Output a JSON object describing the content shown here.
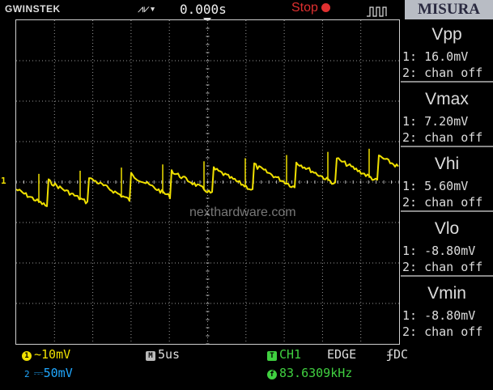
{
  "topbar": {
    "brand": "GWINSTEK",
    "trigger_icon_glyph": "⩘⩗▾",
    "time_delay": "0.000s",
    "status": "Stop",
    "panel_header": "MISURA"
  },
  "channel_marker": "1",
  "watermark": "nexthardware.com",
  "colors": {
    "ch1": "#f0e000",
    "ch2": "#20a8ff",
    "status": "#e03030",
    "accent_green": "#40d040"
  },
  "measurements": [
    {
      "title": "Vpp",
      "ch1": "1: 16.0mV",
      "ch2": "2: chan off"
    },
    {
      "title": "Vmax",
      "ch1": "1: 7.20mV",
      "ch2": "2: chan off"
    },
    {
      "title": "Vhi",
      "ch1": "1: 5.60mV",
      "ch2": "2: chan off"
    },
    {
      "title": "Vlo",
      "ch1": "1: -8.80mV",
      "ch2": "2: chan off"
    },
    {
      "title": "Vmin",
      "ch1": "1: -8.80mV",
      "ch2": "2: chan off"
    }
  ],
  "bottombar": {
    "ch1_badge": "1",
    "ch1_coupling_glyph": "∼",
    "ch1_scale": "10mV",
    "ch2_badge": "2",
    "ch2_coupling_glyph": "⎓",
    "ch2_scale": "50mV",
    "timebase_badge": "M",
    "timebase": "5us",
    "trigger_badge": "T",
    "trigger_source": "CH1",
    "trigger_type": "EDGE",
    "trigger_coupling": "DC",
    "trigger_slope_glyph": "ʄ",
    "freq_badge": "f",
    "frequency": "83.6309kHz"
  }
}
